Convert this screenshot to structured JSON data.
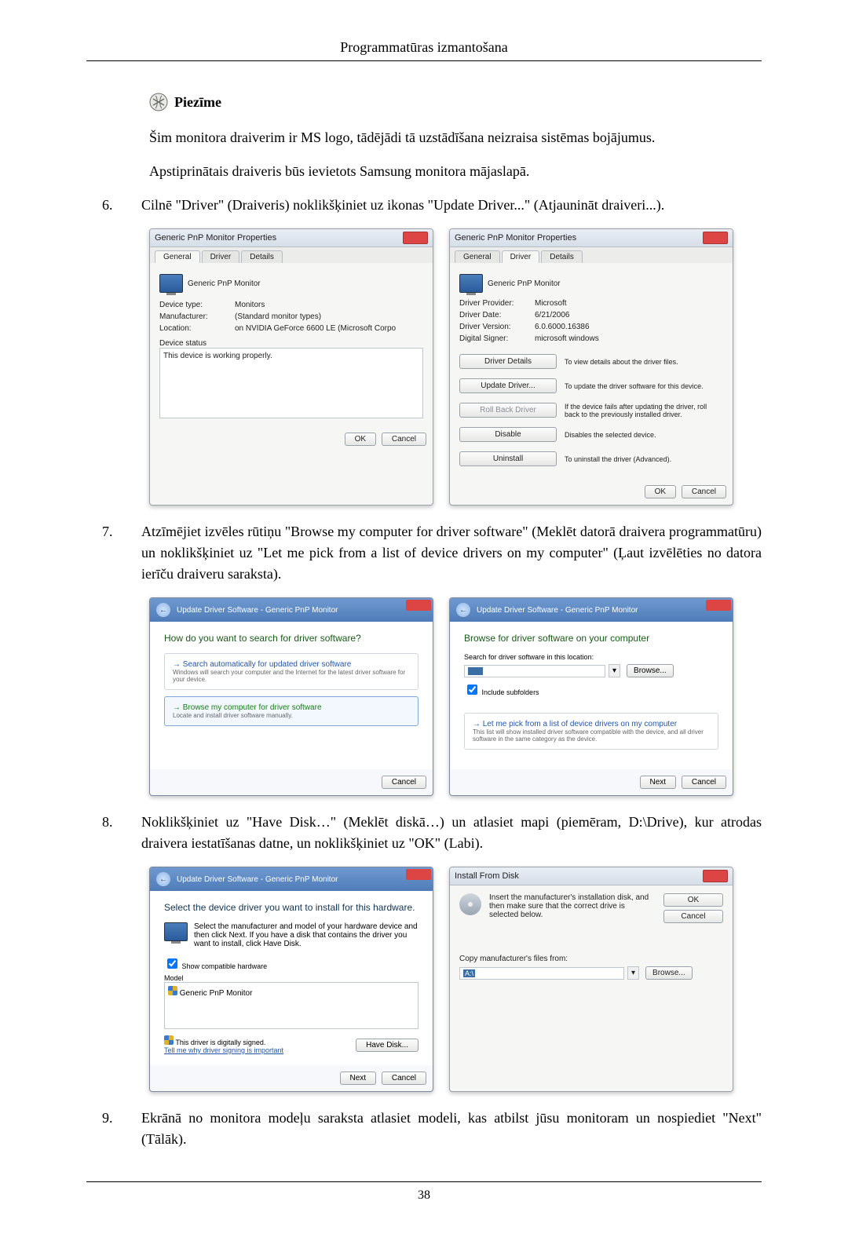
{
  "header_title": "Programmatūras izmantošana",
  "note_label": "Piezīme",
  "note_para_1": "Šim monitora draiverim ir MS logo, tādējādi tā uzstādīšana neizraisa sistēmas bojājumus.",
  "note_para_2": "Apstiprinātais draiveris būs ievietots Samsung monitora mājaslapā.",
  "step6": {
    "num": "6.",
    "text": "Cilnē \"Driver\" (Draiveris) noklikšķiniet uz ikonas \"Update Driver...\" (Atjaunināt draiveri...)."
  },
  "prop_general": {
    "title": "Generic PnP Monitor Properties",
    "tabs": {
      "general": "General",
      "driver": "Driver",
      "details": "Details"
    },
    "heading": "Generic PnP Monitor",
    "devtype_k": "Device type:",
    "devtype_v": "Monitors",
    "manu_k": "Manufacturer:",
    "manu_v": "(Standard monitor types)",
    "loc_k": "Location:",
    "loc_v": "on NVIDIA GeForce 6600 LE (Microsoft Corpo",
    "status_label": "Device status",
    "status_text": "This device is working properly.",
    "ok": "OK",
    "cancel": "Cancel"
  },
  "prop_driver": {
    "title": "Generic PnP Monitor Properties",
    "heading": "Generic PnP Monitor",
    "prov_k": "Driver Provider:",
    "prov_v": "Microsoft",
    "date_k": "Driver Date:",
    "date_v": "6/21/2006",
    "ver_k": "Driver Version:",
    "ver_v": "6.0.6000.16386",
    "sign_k": "Digital Signer:",
    "sign_v": "microsoft windows",
    "btn_details": "Driver Details",
    "desc_details": "To view details about the driver files.",
    "btn_update": "Update Driver...",
    "desc_update": "To update the driver software for this device.",
    "btn_rollback": "Roll Back Driver",
    "desc_rollback": "If the device fails after updating the driver, roll back to the previously installed driver.",
    "btn_disable": "Disable",
    "desc_disable": "Disables the selected device.",
    "btn_uninstall": "Uninstall",
    "desc_uninstall": "To uninstall the driver (Advanced).",
    "ok": "OK",
    "cancel": "Cancel"
  },
  "step7": {
    "num": "7.",
    "text": "Atzīmējiet izvēles rūtiņu \"Browse my computer for driver software\" (Meklēt datorā draivera programmatūru) un noklikšķiniet uz \"Let me pick from a list of device drivers on my computer\" (Ļaut izvēlēties no datora ierīču draiveru saraksta)."
  },
  "wiz1": {
    "title": "Update Driver Software - Generic PnP Monitor",
    "q": "How do you want to search for driver software?",
    "opt1_lead": "Search automatically for updated driver software",
    "opt1_sub": "Windows will search your computer and the Internet for the latest driver software for your device.",
    "opt2_lead": "Browse my computer for driver software",
    "opt2_sub": "Locate and install driver software manually.",
    "cancel": "Cancel"
  },
  "wiz2": {
    "title": "Update Driver Software - Generic PnP Monitor",
    "q": "Browse for driver software on your computer",
    "path_label": "Search for driver software in this location:",
    "browse": "Browse...",
    "include": "Include subfolders",
    "opt_lead": "Let me pick from a list of device drivers on my computer",
    "opt_sub": "This list will show installed driver software compatible with the device, and all driver software in the same category as the device.",
    "next": "Next",
    "cancel": "Cancel"
  },
  "step8": {
    "num": "8.",
    "text": "Noklikšķiniet uz \"Have Disk…\" (Meklēt diskā…) un atlasiet mapi (piemēram, D:\\Drive), kur atrodas draivera iestatīšanas datne, un noklikšķiniet uz \"OK\" (Labi)."
  },
  "wiz3": {
    "title": "Update Driver Software - Generic PnP Monitor",
    "q": "Select the device driver you want to install for this hardware.",
    "sub": "Select the manufacturer and model of your hardware device and then click Next. If you have a disk that contains the driver you want to install, click Have Disk.",
    "show_compat": "Show compatible hardware",
    "model": "Model",
    "model_item": "Generic PnP Monitor",
    "signed": "This driver is digitally signed.",
    "tellme": "Tell me why driver signing is important",
    "have_disk": "Have Disk...",
    "next": "Next",
    "cancel": "Cancel"
  },
  "install_disk": {
    "title": "Install From Disk",
    "msg": "Insert the manufacturer's installation disk, and then make sure that the correct drive is selected below.",
    "copy": "Copy manufacturer's files from:",
    "path": "A:\\",
    "ok": "OK",
    "cancel": "Cancel",
    "browse": "Browse..."
  },
  "step9": {
    "num": "9.",
    "text": "Ekrānā no monitora modeļu saraksta atlasiet modeli, kas atbilst jūsu monitoram un nospiediet \"Next\" (Tālāk)."
  },
  "page_number": "38"
}
